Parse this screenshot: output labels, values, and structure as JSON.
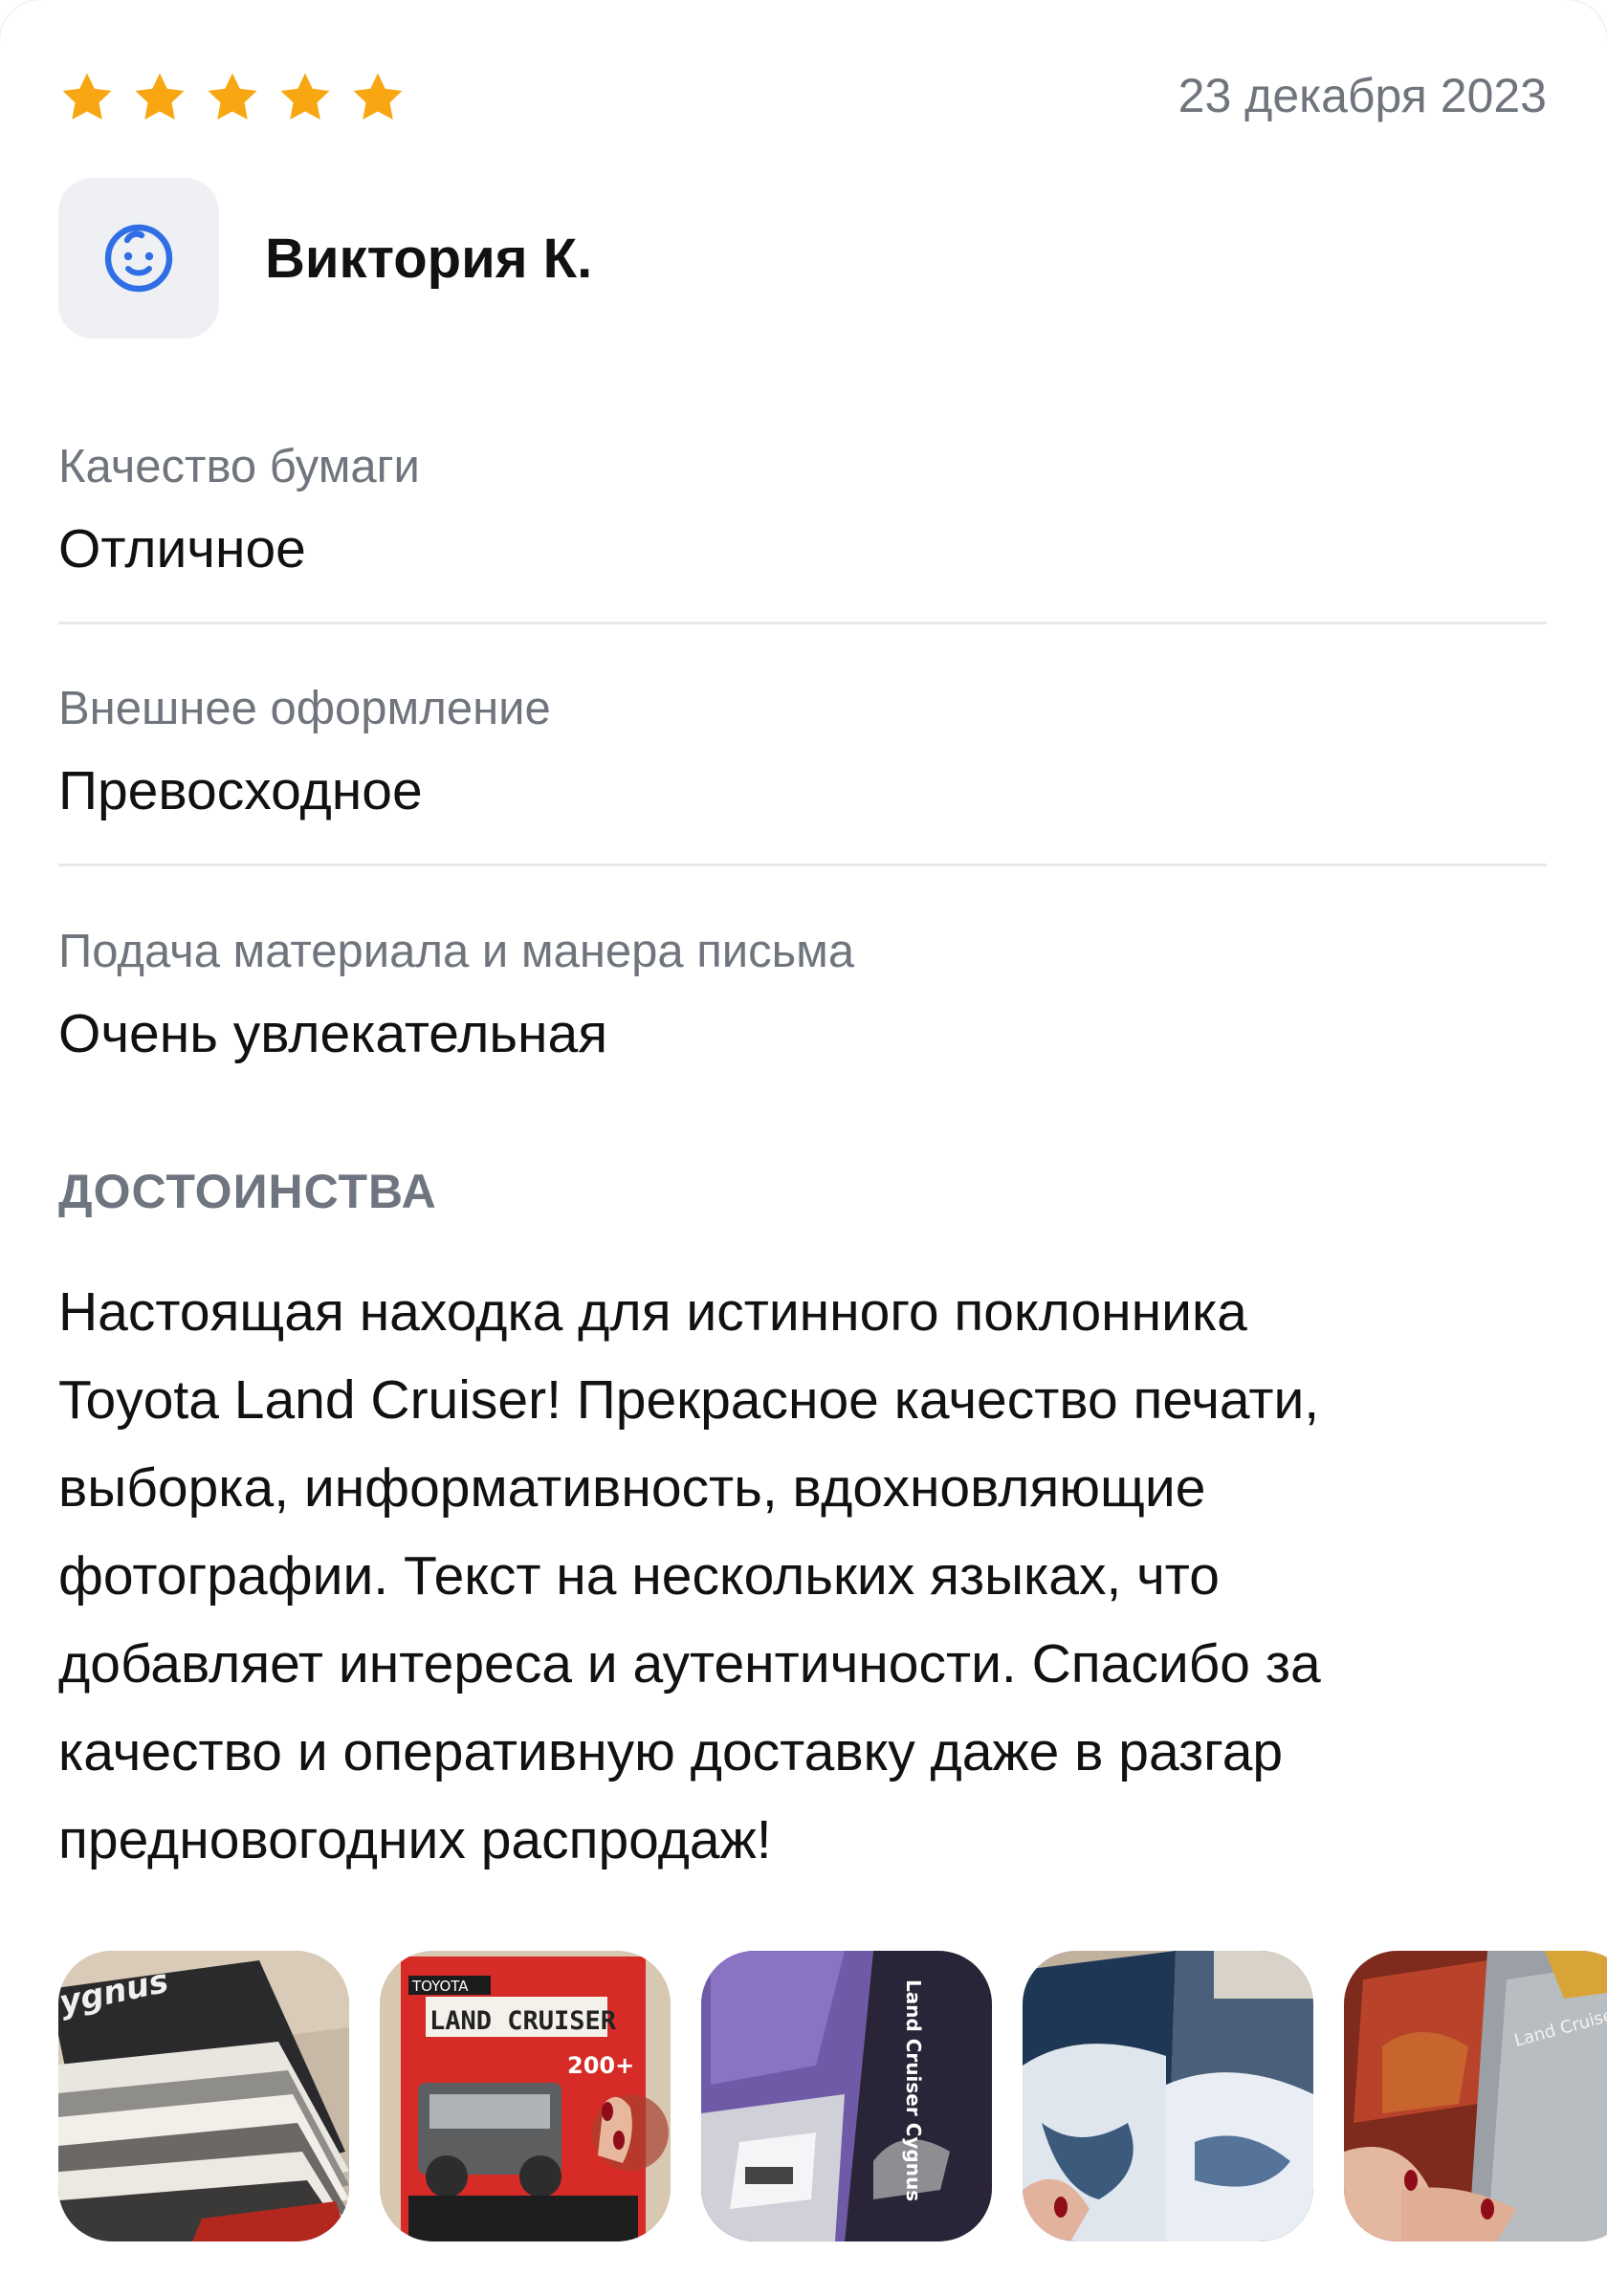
{
  "review": {
    "rating": 5,
    "max_rating": 5,
    "star_color": "#f8a612",
    "date": "23 декабря 2023",
    "author": {
      "name": "Виктория К.",
      "avatar_icon": "baby-face-icon",
      "avatar_icon_color": "#2f6ee5"
    },
    "attributes": [
      {
        "label": "Качество бумаги",
        "value": "Отличное"
      },
      {
        "label": "Внешнее оформление",
        "value": "Превосходное"
      },
      {
        "label": "Подача материала и манера письма",
        "value": "Очень увлекательная"
      }
    ],
    "pros": {
      "title": "ДОСТОИНСТВА",
      "lines": [
        "Настоящая находка для истинного поклонника",
        "Toyota Land Cruiser! Прекрасное качество печати,",
        "выборка, информативность, вдохновляющие",
        "фотографии. Текст на нескольких языках, что",
        "добавляет интереса и аутентичности. Спасибо за",
        "качество и оперативную доставку даже в разгар",
        "предновогодних распродаж!"
      ]
    },
    "photos": [
      {
        "name": "photo-book-pages",
        "caption": "ygnus"
      },
      {
        "name": "photo-book-cover",
        "badge": "TOYOTA",
        "title": "LAND CRUISER",
        "tag": "200+"
      },
      {
        "name": "photo-book-spread-purple",
        "caption": "Land Cruiser Cygnus"
      },
      {
        "name": "photo-book-spread-water"
      },
      {
        "name": "photo-book-spread-red",
        "caption": "Land Cruiser"
      }
    ]
  }
}
